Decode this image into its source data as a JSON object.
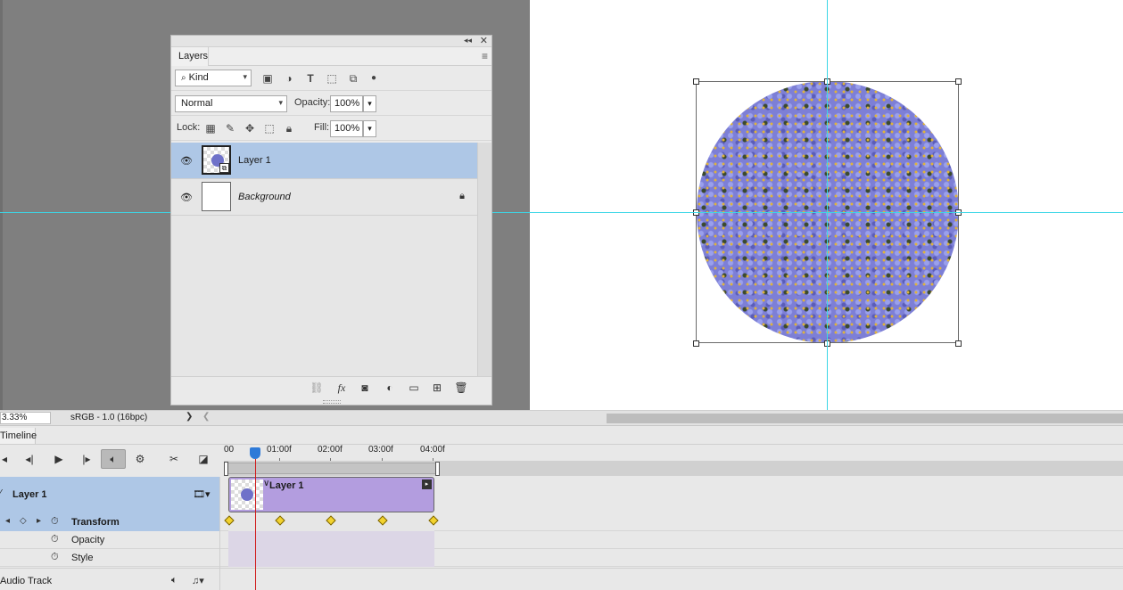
{
  "layers_panel": {
    "tab_label": "Layers",
    "filter_kind": "Kind",
    "blend_mode": "Normal",
    "opacity_label": "Opacity:",
    "opacity_value": "100%",
    "lock_label": "Lock:",
    "fill_label": "Fill:",
    "fill_value": "100%",
    "layers": [
      {
        "name": "Layer 1",
        "selected": true,
        "visible": true
      },
      {
        "name": "Background",
        "selected": false,
        "visible": true,
        "locked": true
      }
    ]
  },
  "status_bar": {
    "zoom": "3.33%",
    "profile": "sRGB - 1.0 (16bpc)"
  },
  "timeline": {
    "tab_label": "Timeline",
    "ruler_labels": [
      "00",
      "01:00f",
      "02:00f",
      "03:00f",
      "04:00f"
    ],
    "layer_track_name": "Layer 1",
    "clip_name": "Layer 1",
    "properties": [
      "Transform",
      "Opacity",
      "Style"
    ],
    "audio_track": "Audio Track"
  },
  "colors": {
    "guide": "#3cd6e6",
    "selection": "#aec7e6",
    "clip": "#b39ddf",
    "keyframe": "#f2d22e",
    "playhead": "#2e7ad8"
  }
}
